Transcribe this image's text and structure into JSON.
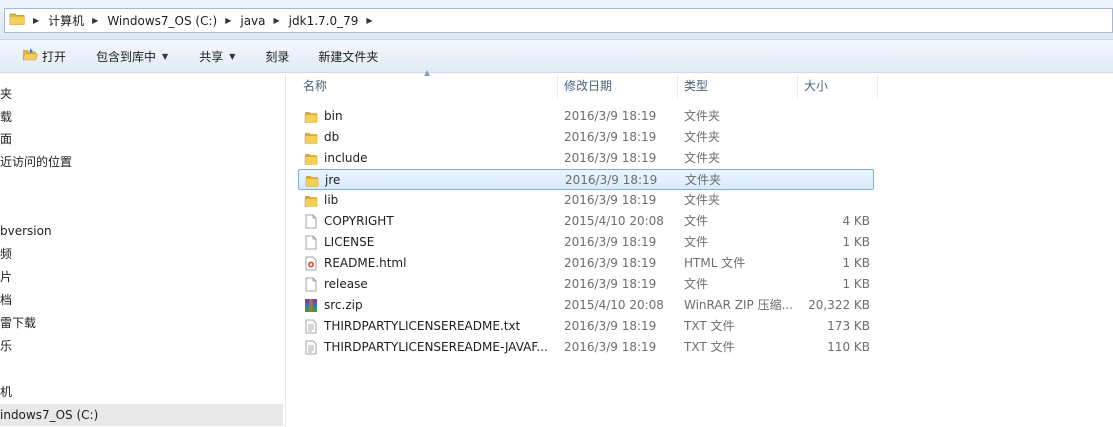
{
  "address": {
    "crumbs": [
      "计算机",
      "Windows7_OS (C:)",
      "java",
      "jdk1.7.0_79"
    ]
  },
  "toolbar": {
    "open_label": "打开",
    "include_label": "包含到库中",
    "share_label": "共享",
    "burn_label": "刻录",
    "newfolder_label": "新建文件夹"
  },
  "nav": {
    "items": [
      "夹",
      "载",
      "面",
      "近访问的位置",
      "bversion",
      "频",
      "片",
      "档",
      "雷下载",
      "乐",
      "机",
      "indows7_OS (C:)"
    ]
  },
  "columns": {
    "name": "名称",
    "date": "修改日期",
    "type": "类型",
    "size": "大小"
  },
  "files": [
    {
      "name": "bin",
      "date": "2016/3/9 18:19",
      "type": "文件夹",
      "size": "",
      "icon": "folder-icon"
    },
    {
      "name": "db",
      "date": "2016/3/9 18:19",
      "type": "文件夹",
      "size": "",
      "icon": "folder-icon"
    },
    {
      "name": "include",
      "date": "2016/3/9 18:19",
      "type": "文件夹",
      "size": "",
      "icon": "folder-icon"
    },
    {
      "name": "jre",
      "date": "2016/3/9 18:19",
      "type": "文件夹",
      "size": "",
      "icon": "folder-icon",
      "selected": true
    },
    {
      "name": "lib",
      "date": "2016/3/9 18:19",
      "type": "文件夹",
      "size": "",
      "icon": "folder-icon"
    },
    {
      "name": "COPYRIGHT",
      "date": "2015/4/10 20:08",
      "type": "文件",
      "size": "4 KB",
      "icon": "file-icon"
    },
    {
      "name": "LICENSE",
      "date": "2016/3/9 18:19",
      "type": "文件",
      "size": "1 KB",
      "icon": "file-icon"
    },
    {
      "name": "README.html",
      "date": "2016/3/9 18:19",
      "type": "HTML 文件",
      "size": "1 KB",
      "icon": "html-file-icon"
    },
    {
      "name": "release",
      "date": "2016/3/9 18:19",
      "type": "文件",
      "size": "1 KB",
      "icon": "file-icon"
    },
    {
      "name": "src.zip",
      "date": "2015/4/10 20:08",
      "type": "WinRAR ZIP 压缩...",
      "size": "20,322 KB",
      "icon": "winrar-zip-icon"
    },
    {
      "name": "THIRDPARTYLICENSEREADME.txt",
      "date": "2016/3/9 18:19",
      "type": "TXT 文件",
      "size": "173 KB",
      "icon": "text-file-icon"
    },
    {
      "name": "THIRDPARTYLICENSEREADME-JAVAF...",
      "date": "2016/3/9 18:19",
      "type": "TXT 文件",
      "size": "110 KB",
      "icon": "text-file-icon"
    }
  ]
}
